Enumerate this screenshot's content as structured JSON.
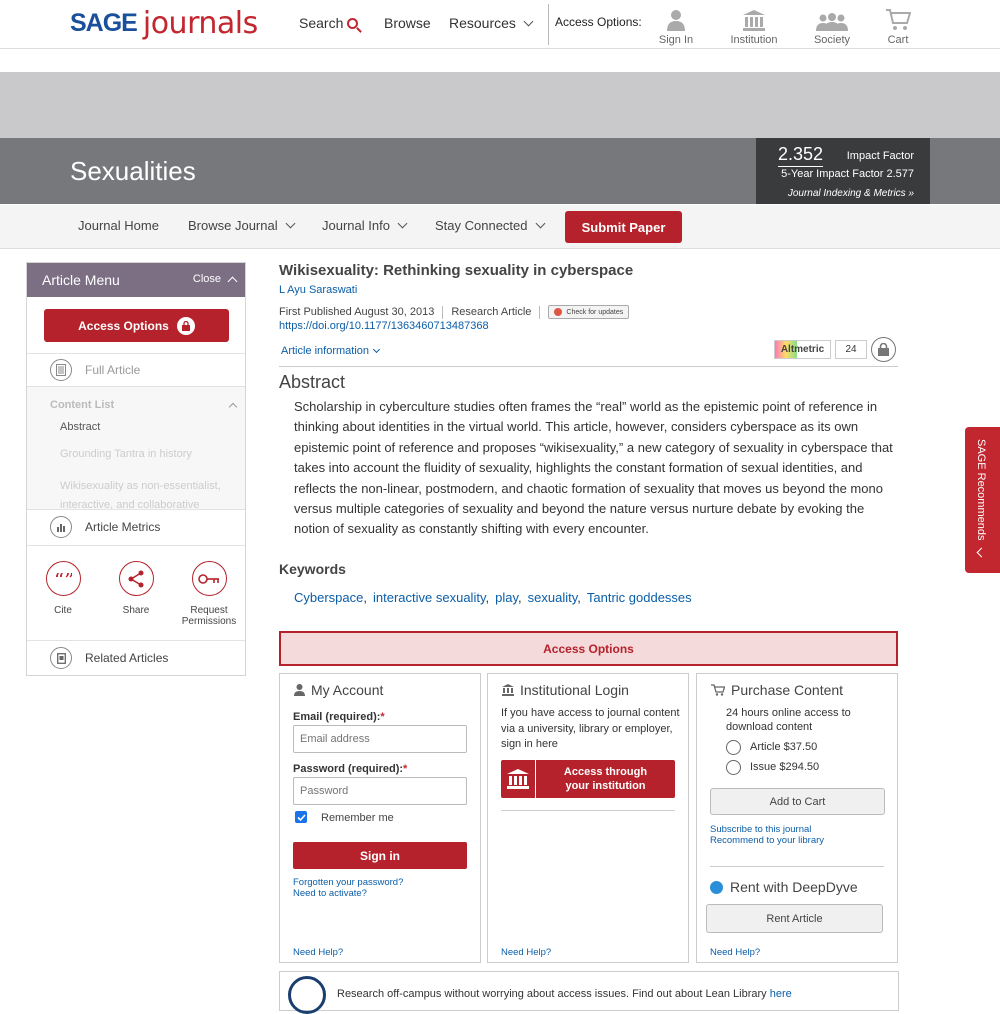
{
  "header": {
    "logo_sage": "SAGE",
    "logo_journals": "journals",
    "nav": {
      "search": "Search",
      "browse": "Browse",
      "resources": "Resources"
    },
    "access_options_label": "Access Options:",
    "access_icons": {
      "sign_in": "Sign In",
      "institution": "Institution",
      "society": "Society",
      "cart": "Cart"
    }
  },
  "journal": {
    "title": "Sexualities",
    "impact_factor_value": "2.352",
    "impact_factor_label": "Impact Factor",
    "five_year_impact": "5-Year Impact Factor 2.577",
    "indexing_link": "Journal Indexing & Metrics »"
  },
  "journal_nav": {
    "home": "Journal Home",
    "browse": "Browse Journal",
    "info": "Journal Info",
    "stay": "Stay Connected",
    "submit": "Submit Paper"
  },
  "sidebar": {
    "title": "Article Menu",
    "close": "Close",
    "access_button": "Access Options",
    "full_article": "Full Article",
    "content_list_heading": "Content List",
    "content_list": [
      "Abstract",
      "Grounding Tantra in history",
      "Wikisexuality as non-essentialist, interactive, and collaborative"
    ],
    "metrics": "Article Metrics",
    "tools": {
      "cite": "Cite",
      "share": "Share",
      "permissions": "Request Permissions"
    },
    "related": "Related Articles"
  },
  "article": {
    "title": "Wikisexuality: Rethinking sexuality in cyberspace",
    "author": "L Ayu Saraswati",
    "published": "First Published August 30, 2013",
    "type": "Research Article",
    "check_updates": "Check for updates",
    "doi": "https://doi.org/10.1177/1363460713487368",
    "info_toggle": "Article information",
    "altmetric_label": "Altmetric",
    "altmetric_score": "24",
    "abstract_heading": "Abstract",
    "abstract": "Scholarship in cyberculture studies often frames the “real” world as the epistemic point of reference in thinking about identities in the virtual world. This article, however, considers cyberspace as its own epistemic point of reference and proposes “wikisexuality,” a new category of sexuality in cyberspace that takes into account the fluidity of sexuality, highlights the constant formation of sexual identities, and reflects the non-linear, postmodern, and chaotic formation of sexuality that moves us beyond the mono versus multiple categories of sexuality and beyond the nature versus nurture debate by evoking the notion of sexuality as constantly shifting with every encounter.",
    "keywords_heading": "Keywords",
    "keywords": [
      "Cyberspace",
      "interactive sexuality",
      "play",
      "sexuality",
      "Tantric goddesses"
    ]
  },
  "access": {
    "bar_title": "Access Options",
    "account": {
      "title": "My Account",
      "email_label": "Email (required):",
      "email_placeholder": "Email address",
      "password_label": "Password (required):",
      "password_placeholder": "Password",
      "required_mark": "*",
      "remember": "Remember me",
      "remember_checked": true,
      "sign_in": "Sign in",
      "forgot": "Forgotten your password?",
      "activate": "Need to activate?",
      "help": "Need Help?"
    },
    "institution": {
      "title": "Institutional Login",
      "text": "If you have access to journal content via a university, library or employer, sign in here",
      "button_line1": "Access through",
      "button_line2": "your institution",
      "help": "Need Help?"
    },
    "purchase": {
      "title": "Purchase Content",
      "text": "24 hours online access to download content",
      "option_article": "Article",
      "price_article": "$37.50",
      "option_issue": "Issue",
      "price_issue": "$294.50",
      "add_to_cart": "Add to Cart",
      "subscribe": "Subscribe to this journal",
      "recommend": "Recommend to your library",
      "deepdyve_title": "Rent with DeepDyve",
      "rent": "Rent Article",
      "help": "Need Help?"
    }
  },
  "lean_library": {
    "text": "Research off-campus without worrying about access issues. Find out about Lean Library",
    "link": "here"
  },
  "recommends_tab": "SAGE Recommends",
  "colors": {
    "brand_red": "#b5222b",
    "link_blue": "#0b5ea8",
    "sidebar_header": "#7c6f84"
  }
}
